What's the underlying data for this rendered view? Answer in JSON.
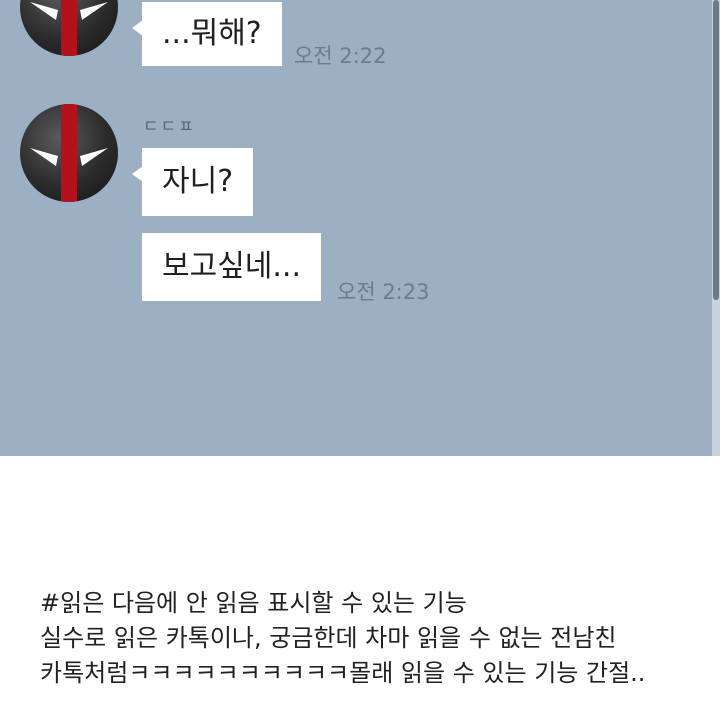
{
  "chat": {
    "sender_name": "ㄷㄷㅍ",
    "messages": [
      {
        "text": "...뭐해?",
        "time": "오전 2:22"
      },
      {
        "text": "자니?",
        "time": ""
      },
      {
        "text": "보고싶네...",
        "time": "오전 2:23"
      }
    ],
    "avatar_icon": "deadpool-mask-icon"
  },
  "caption": {
    "lines": [
      "#읽은 다음에 안 읽음 표시할 수 있는 기능",
      "실수로 읽은 카톡이나, 궁금한데 차마 읽을 수 없는 전남친",
      "카톡처럼ㅋㅋㅋㅋㅋㅋㅋㅋㅋㅋ몰래 읽을 수 있는 기능 간절.."
    ]
  },
  "colors": {
    "chat_background": "#9dafc3",
    "bubble": "#ffffff",
    "avatar_red": "#b3121c"
  }
}
